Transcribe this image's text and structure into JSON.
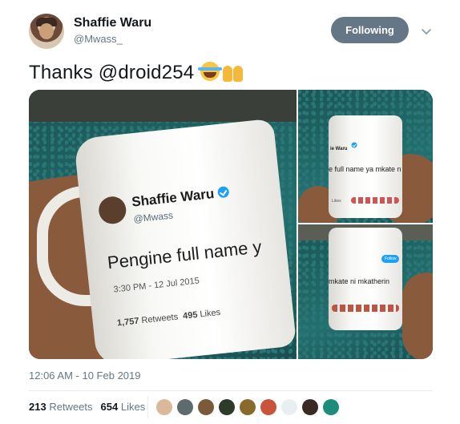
{
  "author": {
    "display_name": "Shaffie Waru",
    "handle": "@Mwass_",
    "avatar_icon": "profile-photo"
  },
  "follow_button": {
    "label": "Following",
    "color": "#657786"
  },
  "menu": {
    "icon": "chevron-down-icon"
  },
  "tweet": {
    "text": "Thanks @droid254",
    "emojis": [
      "face-with-tears-of-joy",
      "raising-hands"
    ]
  },
  "media": {
    "main_photo": {
      "mug_name": "Shaffie Waru",
      "mug_handle": "@Mwass",
      "mug_text": "Pengine full name y",
      "mug_time": "3:30 PM - 12 Jul 2015",
      "mug_retweets": "1,757",
      "mug_retweets_label": "Retweets",
      "mug_likes": "495",
      "mug_likes_label": "Likes"
    },
    "top_right_photo": {
      "mug_name": "ie Waru",
      "mug_text": "e full name ya mkate n",
      "mug_likes": "Likes"
    },
    "bottom_right_photo": {
      "mug_follow": "Follow",
      "mug_text": "mkate ni mkatherin"
    }
  },
  "timestamp": "12:06 AM - 10 Feb 2019",
  "stats": {
    "retweets_count": "213",
    "retweets_label": "Retweets",
    "likes_count": "654",
    "likes_label": "Likes"
  },
  "likers": [
    "liker-avatar-1",
    "liker-avatar-2",
    "liker-avatar-3",
    "liker-avatar-4",
    "liker-avatar-5",
    "liker-avatar-6",
    "liker-avatar-7",
    "liker-avatar-8",
    "liker-avatar-9",
    "liker-avatar-10"
  ]
}
